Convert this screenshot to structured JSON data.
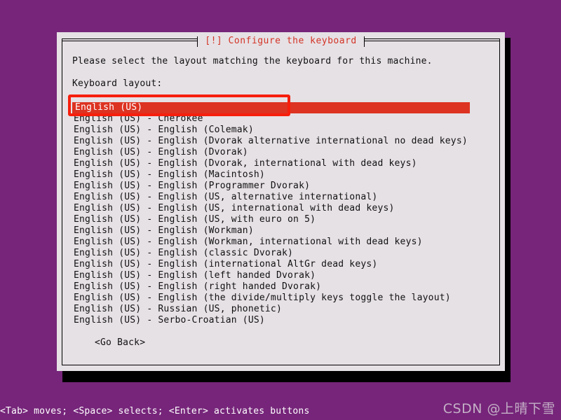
{
  "desktop": {
    "background_color": "#76257a"
  },
  "dialog": {
    "title": "[!] Configure the keyboard",
    "title_color": "#d33426",
    "background_color": "#e6e1e5",
    "prompt": "Please select the layout matching the keyboard for this machine.",
    "field_label": "Keyboard layout:",
    "selection_color": "#dd3322",
    "annotation_color": "#f61f0d",
    "go_back_label": "<Go Back>"
  },
  "layout_list": {
    "selected_index": 0,
    "items": [
      "English (US)",
      "English (US) - Cherokee",
      "English (US) - English (Colemak)",
      "English (US) - English (Dvorak alternative international no dead keys)",
      "English (US) - English (Dvorak)",
      "English (US) - English (Dvorak, international with dead keys)",
      "English (US) - English (Macintosh)",
      "English (US) - English (Programmer Dvorak)",
      "English (US) - English (US, alternative international)",
      "English (US) - English (US, international with dead keys)",
      "English (US) - English (US, with euro on 5)",
      "English (US) - English (Workman)",
      "English (US) - English (Workman, international with dead keys)",
      "English (US) - English (classic Dvorak)",
      "English (US) - English (international AltGr dead keys)",
      "English (US) - English (left handed Dvorak)",
      "English (US) - English (right handed Dvorak)",
      "English (US) - English (the divide/multiply keys toggle the layout)",
      "English (US) - Russian (US, phonetic)",
      "English (US) - Serbo-Croatian (US)"
    ]
  },
  "status_bar": {
    "text": "<Tab> moves; <Space> selects; <Enter> activates buttons"
  },
  "watermark": {
    "text": "CSDN @上晴下雪"
  }
}
